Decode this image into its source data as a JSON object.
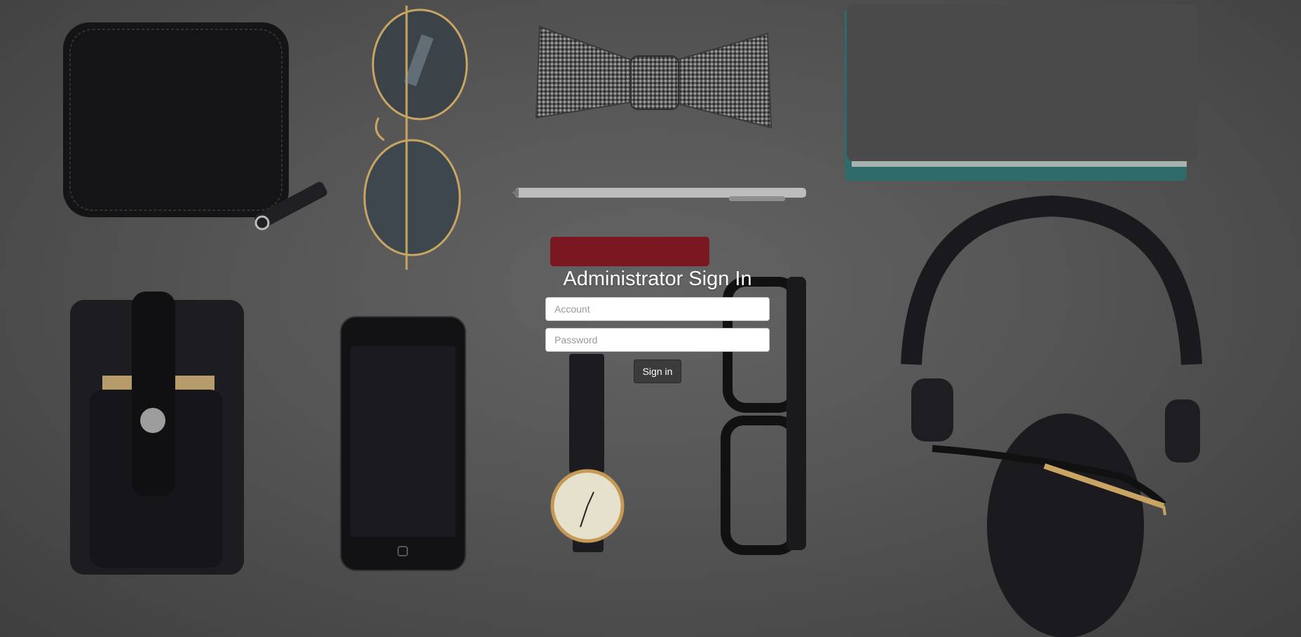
{
  "login": {
    "title": "Administrator Sign In",
    "account_placeholder": "Account",
    "password_placeholder": "Password",
    "signin_label": "Sign in"
  }
}
